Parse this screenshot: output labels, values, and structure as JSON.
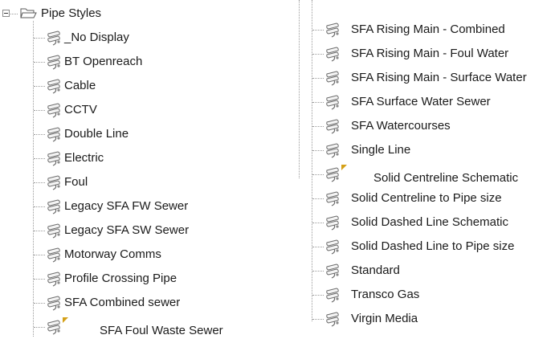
{
  "tree": {
    "root": {
      "label": "Pipe Styles",
      "icon": "folder-open-icon",
      "expander": "minus"
    },
    "left_items": [
      {
        "label": "_No Display"
      },
      {
        "label": "BT Openreach"
      },
      {
        "label": "Cable"
      },
      {
        "label": "CCTV"
      },
      {
        "label": "Double Line"
      },
      {
        "label": "Electric"
      },
      {
        "label": "Foul"
      },
      {
        "label": "Legacy SFA FW Sewer"
      },
      {
        "label": "Legacy SFA SW Sewer"
      },
      {
        "label": "Motorway Comms"
      },
      {
        "label": "Profile Crossing Pipe"
      },
      {
        "label": "SFA Combined sewer"
      },
      {
        "label": "SFA Foul Waste Sewer",
        "marked": true
      }
    ],
    "right_items": [
      {
        "label": "SFA Rising Main - Combined"
      },
      {
        "label": "SFA Rising Main - Foul Water"
      },
      {
        "label": "SFA Rising Main - Surface Water"
      },
      {
        "label": "SFA Surface Water Sewer"
      },
      {
        "label": "SFA Watercourses"
      },
      {
        "label": "Single Line"
      },
      {
        "label": "Solid Centreline Schematic",
        "marked": true
      },
      {
        "label": "Solid Centreline to Pipe size"
      },
      {
        "label": "Solid Dashed Line Schematic"
      },
      {
        "label": "Solid Dashed Line to Pipe size"
      },
      {
        "label": "Standard"
      },
      {
        "label": "Transco Gas"
      },
      {
        "label": "Virgin Media"
      }
    ],
    "item_icon": "pipe-style-icon",
    "colors": {
      "connector": "#9a9a9a",
      "marker": "#d4a017",
      "icon_stroke": "#6b6b6b",
      "icon_fill": "#f2f2f2"
    }
  }
}
